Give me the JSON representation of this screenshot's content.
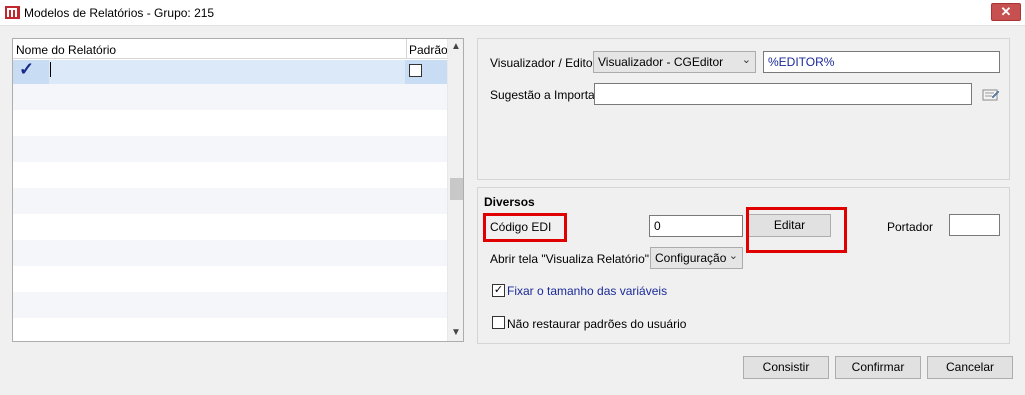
{
  "window": {
    "title": "Modelos de Relatórios - Grupo: 215",
    "close_label": "✕"
  },
  "grid": {
    "columns": [
      "Nome do Relatório",
      "Padrão"
    ],
    "rows": [
      {
        "selected": true,
        "checked_mark": "✓",
        "name": "",
        "padrao": false
      }
    ],
    "scroll_up": "▲",
    "scroll_down": "▼"
  },
  "viewer": {
    "label": "Visualizador / Editor",
    "selected": "Visualizador - CGEditor",
    "value": "%EDITOR%"
  },
  "suggestion": {
    "label": "Sugestão a Importar",
    "value": ""
  },
  "diversos": {
    "title": "Diversos",
    "codigo_edi_label": "Código EDI",
    "codigo_edi_value": "0",
    "editar_label": "Editar",
    "portador_label": "Portador",
    "portador_value": "",
    "abrir_label": "Abrir tela \"Visualiza Relatório\"",
    "abrir_selected": "Configuração",
    "fixar_label": "Fixar o tamanho das variáveis",
    "fixar_checked": true,
    "nao_restaurar_label": "Não restaurar padrões do usuário",
    "nao_restaurar_checked": false
  },
  "footer": {
    "consistir": "Consistir",
    "confirmar": "Confirmar",
    "cancelar": "Cancelar"
  },
  "colors": {
    "selection": "#c8ddf4",
    "highlight": "#e00000",
    "link": "#1a2a99"
  }
}
